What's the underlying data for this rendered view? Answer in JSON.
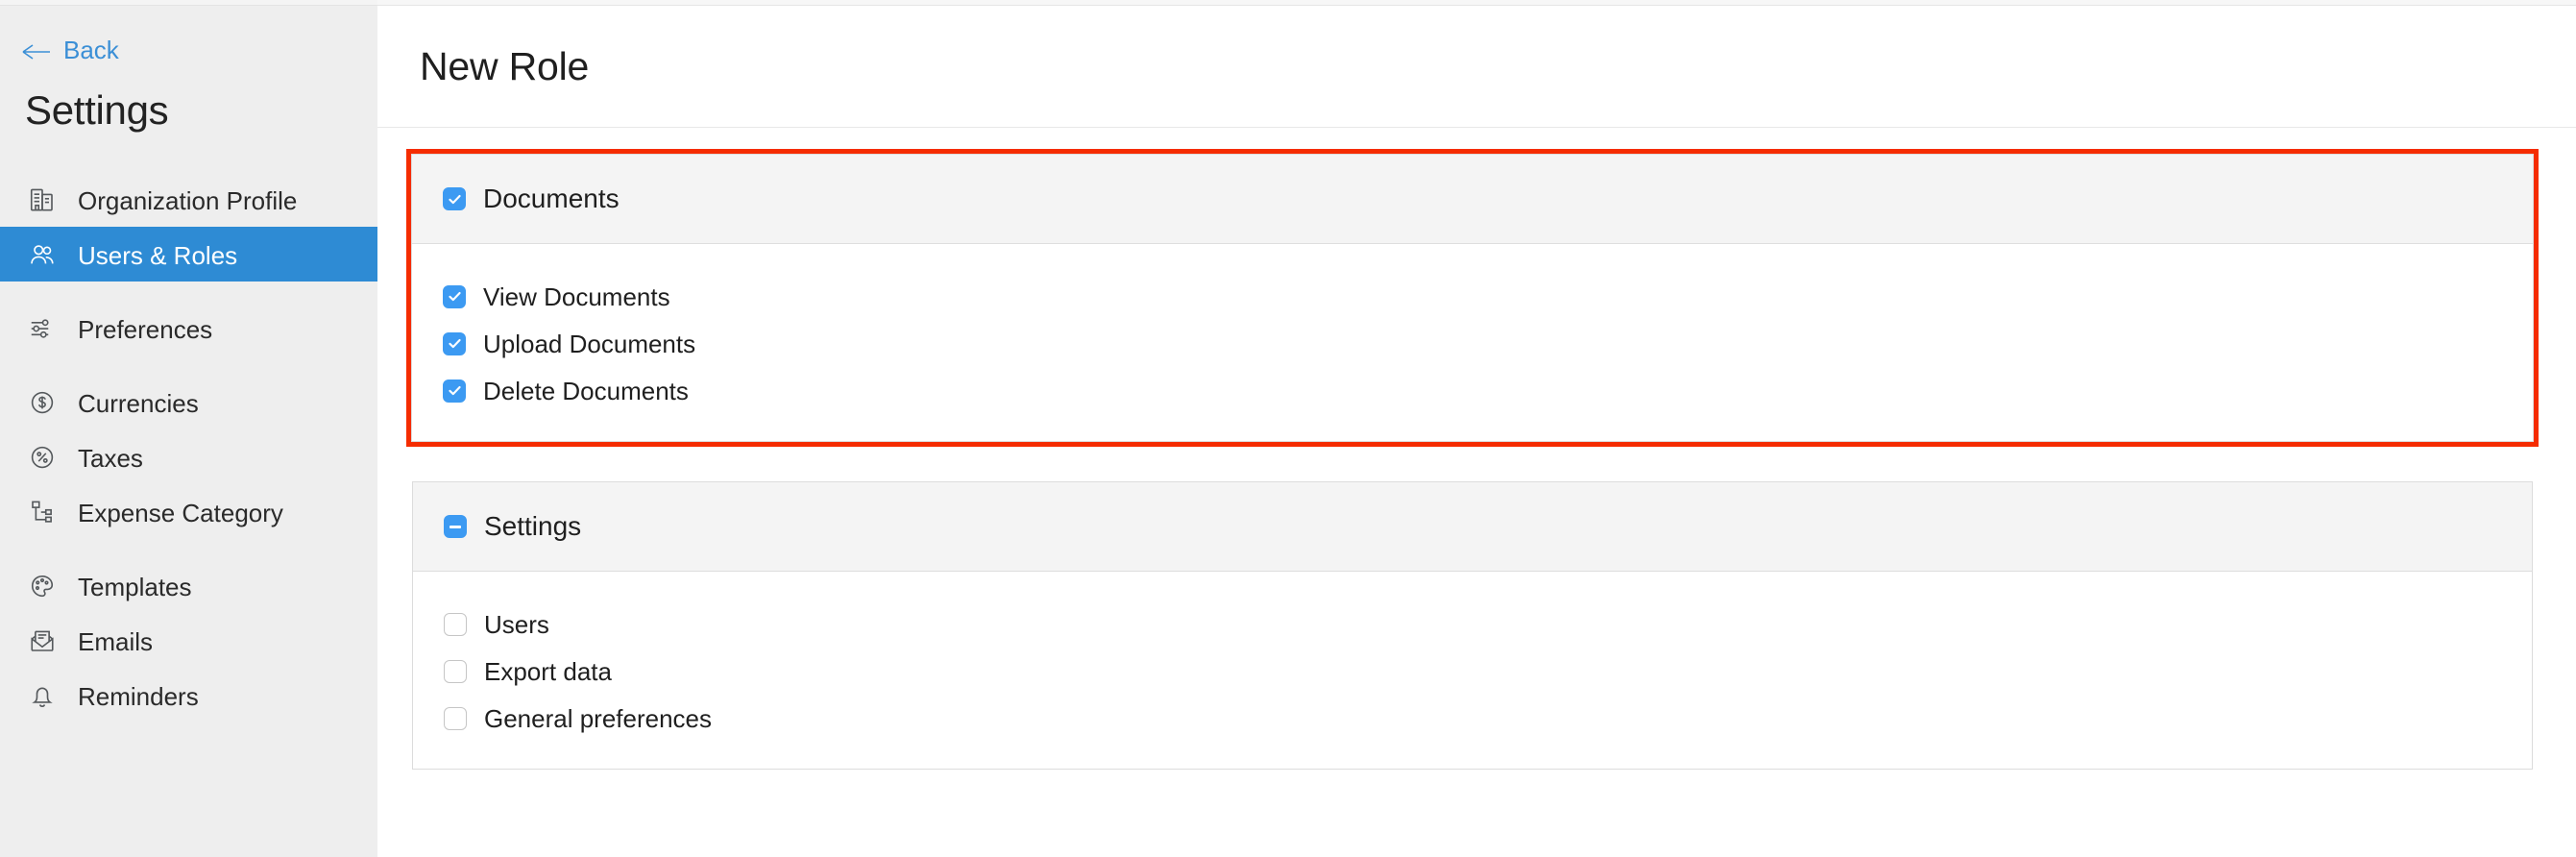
{
  "sidebar": {
    "back_label": "Back",
    "title": "Settings",
    "groups": [
      {
        "items": [
          {
            "label": "Organization Profile",
            "icon": "building-icon",
            "active": false
          },
          {
            "label": "Users & Roles",
            "icon": "users-icon",
            "active": true
          }
        ]
      },
      {
        "items": [
          {
            "label": "Preferences",
            "icon": "sliders-icon",
            "active": false
          }
        ]
      },
      {
        "items": [
          {
            "label": "Currencies",
            "icon": "dollar-circle-icon",
            "active": false
          },
          {
            "label": "Taxes",
            "icon": "percent-circle-icon",
            "active": false
          },
          {
            "label": "Expense Category",
            "icon": "hierarchy-icon",
            "active": false
          }
        ]
      },
      {
        "items": [
          {
            "label": "Templates",
            "icon": "palette-icon",
            "active": false
          },
          {
            "label": "Emails",
            "icon": "envelope-icon",
            "active": false
          },
          {
            "label": "Reminders",
            "icon": "bell-icon",
            "active": false
          }
        ]
      }
    ]
  },
  "header": {
    "title": "New Role"
  },
  "colors": {
    "accent_blue": "#3c9af2",
    "sidebar_active": "#2e8bd4",
    "highlight_red": "#f52c00",
    "link_blue": "#3b8fd6"
  },
  "permissions": {
    "sections": [
      {
        "id": "documents",
        "title": "Documents",
        "state": "checked",
        "highlighted": true,
        "items": [
          {
            "label": "View Documents",
            "state": "checked"
          },
          {
            "label": "Upload Documents",
            "state": "checked"
          },
          {
            "label": "Delete Documents",
            "state": "checked"
          }
        ]
      },
      {
        "id": "settings",
        "title": "Settings",
        "state": "indeterminate",
        "highlighted": false,
        "items": [
          {
            "label": "Users",
            "state": "unchecked"
          },
          {
            "label": "Export data",
            "state": "unchecked"
          },
          {
            "label": "General preferences",
            "state": "unchecked"
          }
        ]
      }
    ]
  }
}
